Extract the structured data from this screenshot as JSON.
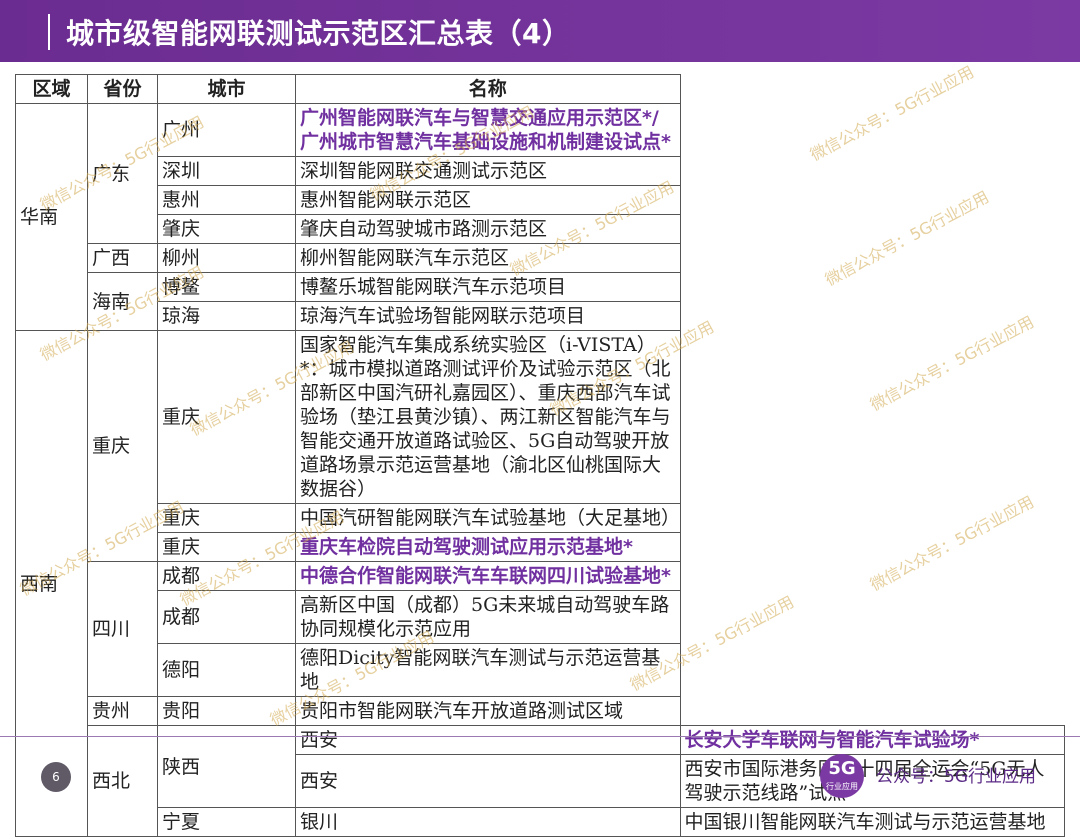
{
  "header": {
    "title": "城市级智能网联测试示范区汇总表（4）"
  },
  "table": {
    "headers": [
      "区域",
      "省份",
      "城市",
      "名称"
    ],
    "regions": [
      "华南",
      "西南",
      "西北"
    ],
    "provinces": [
      "广东",
      "广西",
      "海南",
      "重庆",
      "四川",
      "贵州",
      "陕西",
      "宁夏"
    ],
    "rows": [
      {
        "city": "广州",
        "name": "广州智能网联汽车与智慧交通应用示范区*/广州城市智慧汽车基础设施和机制建设试点*"
      },
      {
        "city": "深圳",
        "name": "深圳智能网联交通测试示范区"
      },
      {
        "city": "惠州",
        "name": "惠州智能网联示范区"
      },
      {
        "city": "肇庆",
        "name": "肇庆自动驾驶城市路测示范区"
      },
      {
        "city": "柳州",
        "name": "柳州智能网联汽车示范区"
      },
      {
        "city": "博鳌",
        "name": "博鳌乐城智能网联汽车示范项目"
      },
      {
        "city": "琼海",
        "name": "琼海汽车试验场智能网联示范项目"
      },
      {
        "city": "重庆",
        "name_bold": "国家智能汽车集成系统实验区（i-VISTA）*",
        "name": "：城市模拟道路测试评价及试验示范区（北部新区中国汽研礼嘉园区）、重庆西部汽车试验场（垫江县黄沙镇）、两江新区智能汽车与智能交通开放道路试验区、5G自动驾驶开放道路场景示范运营基地（渝北区仙桃国际大数据谷）"
      },
      {
        "city": "重庆",
        "name": "中国汽研智能网联汽车试验基地（大足基地）"
      },
      {
        "city": "重庆",
        "name": "重庆车检院自动驾驶测试应用示范基地*"
      },
      {
        "city": "成都",
        "name": "中德合作智能网联汽车车联网四川试验基地*"
      },
      {
        "city": "成都",
        "name": "高新区中国（成都）5G未来城自动驾驶车路协同规模化示范应用"
      },
      {
        "city": "德阳",
        "name": "德阳Dicity智能网联汽车测试与示范运营基地"
      },
      {
        "city": "贵阳",
        "name": "贵阳市智能网联汽车开放道路测试区域"
      },
      {
        "city": "西安",
        "name": "长安大学车联网与智能汽车试验场*"
      },
      {
        "city": "西安",
        "name": "西安市国际港务区第十四届全运会“5G无人驾驶示范线路”试点"
      },
      {
        "city": "银川",
        "name": "中国银川智能网联汽车测试与示范运营基地"
      }
    ]
  },
  "watermark": {
    "text": "微信公众号：5G行业应用"
  },
  "footer": {
    "page_number": "6",
    "logo_main": "5G",
    "logo_sub": "行业应用",
    "account_text": "公众号：5G行业应用"
  },
  "colors": {
    "accent": "#7030a0",
    "header_bg": "#6b2c91"
  }
}
